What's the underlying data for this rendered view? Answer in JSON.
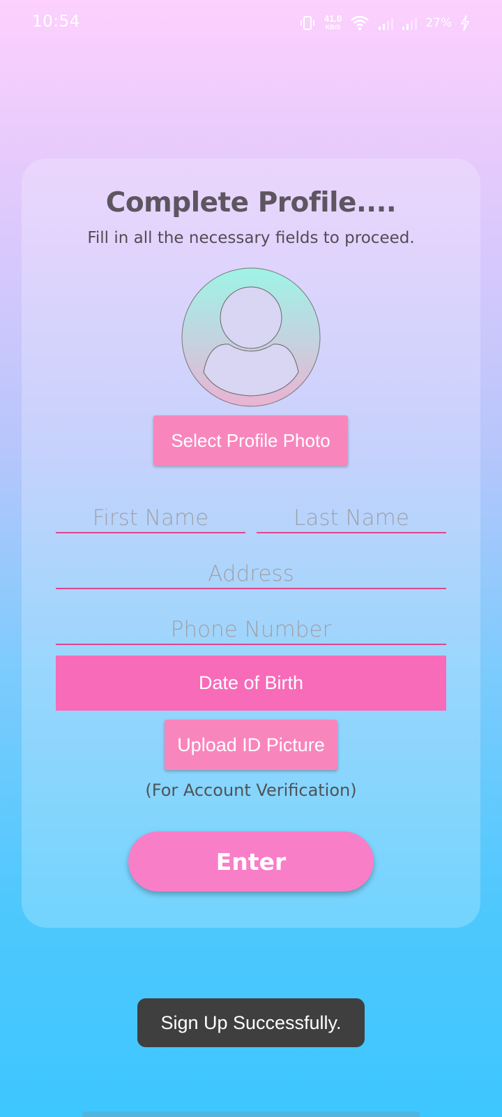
{
  "status_bar": {
    "time": "10:54",
    "net_speed_value": "41.0",
    "net_speed_unit": "KB/S",
    "battery_percent": "27%",
    "icons": [
      "vibrate-icon",
      "wifi-icon",
      "signal-icon",
      "signal-icon",
      "charging-icon"
    ]
  },
  "form": {
    "title": "Complete Profile....",
    "subtitle": "Fill in all the necessary fields to proceed.",
    "avatar_icon": "person-avatar-icon",
    "select_photo_label": "Select Profile Photo",
    "first_name_placeholder": "First Name",
    "last_name_placeholder": "Last Name",
    "address_placeholder": "Address",
    "phone_placeholder": "Phone Number",
    "dob_label": "Date of Birth",
    "upload_id_label": "Upload ID Picture",
    "verification_note": "(For Account Verification)",
    "enter_label": "Enter"
  },
  "toast": {
    "message": "Sign Up Successfully."
  },
  "colors": {
    "accent_pink": "#f886bd",
    "dob_pink": "#f76bb9",
    "underline": "#e0458d",
    "toast_bg": "#3f3f3f"
  }
}
